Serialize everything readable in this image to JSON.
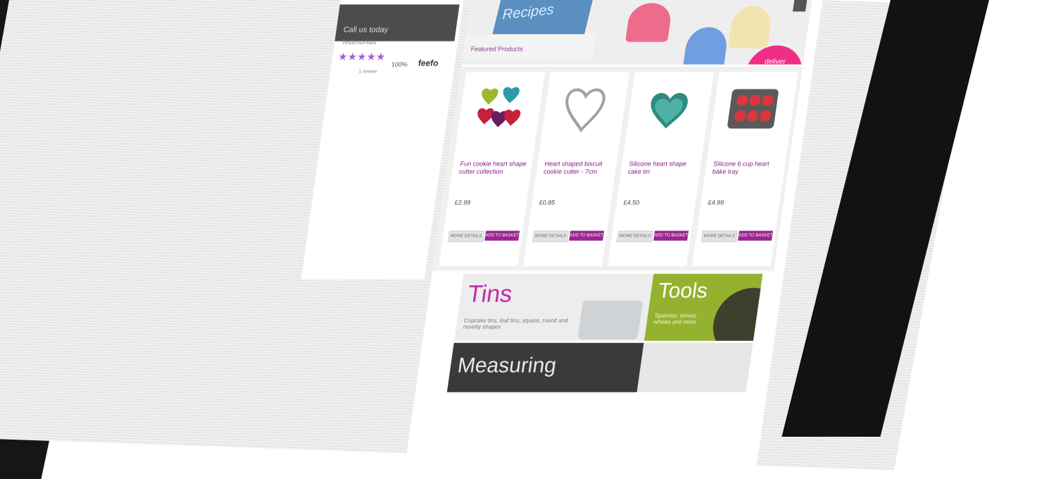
{
  "sidebar": {
    "account_text": "Call us today",
    "testimonials_label": "Testimonials",
    "stars": "★★★★★",
    "stars_sub": "1 review",
    "rating_percent": "100%",
    "rating_brand": "feefo"
  },
  "hero": {
    "tin_label": "Recipes",
    "badge_text": "deliver everywhere",
    "next_arrow": "›"
  },
  "featured": {
    "header": "Featured Products"
  },
  "products": [
    {
      "name": "Fun cookie heart shape cutter collection",
      "price": "£2.99"
    },
    {
      "name": "Heart shaped biscuit cookie cutter - 7cm",
      "price": "£0.85"
    },
    {
      "name": "Silicone heart shape cake tin",
      "price": "£4.50"
    },
    {
      "name": "Silicone 6 cup heart bake tray",
      "price": "£4.99"
    }
  ],
  "buttons": {
    "details": "MORE DETAILS",
    "add_to_cart": "ADD TO BASKET"
  },
  "categories": {
    "tins": {
      "title": "Tins",
      "sub": "Cupcake tins, loaf tins, square, round and novelty shapes"
    },
    "tools": {
      "title": "Tools",
      "sub": "Spatulas, sieves, whisks and more"
    },
    "measuring": {
      "title": "Measuring"
    }
  },
  "colors": {
    "accent": "#9a2690",
    "stars": "#a45ee0",
    "tools_green": "#94b22f",
    "badge_pink": "#ef2f85"
  }
}
